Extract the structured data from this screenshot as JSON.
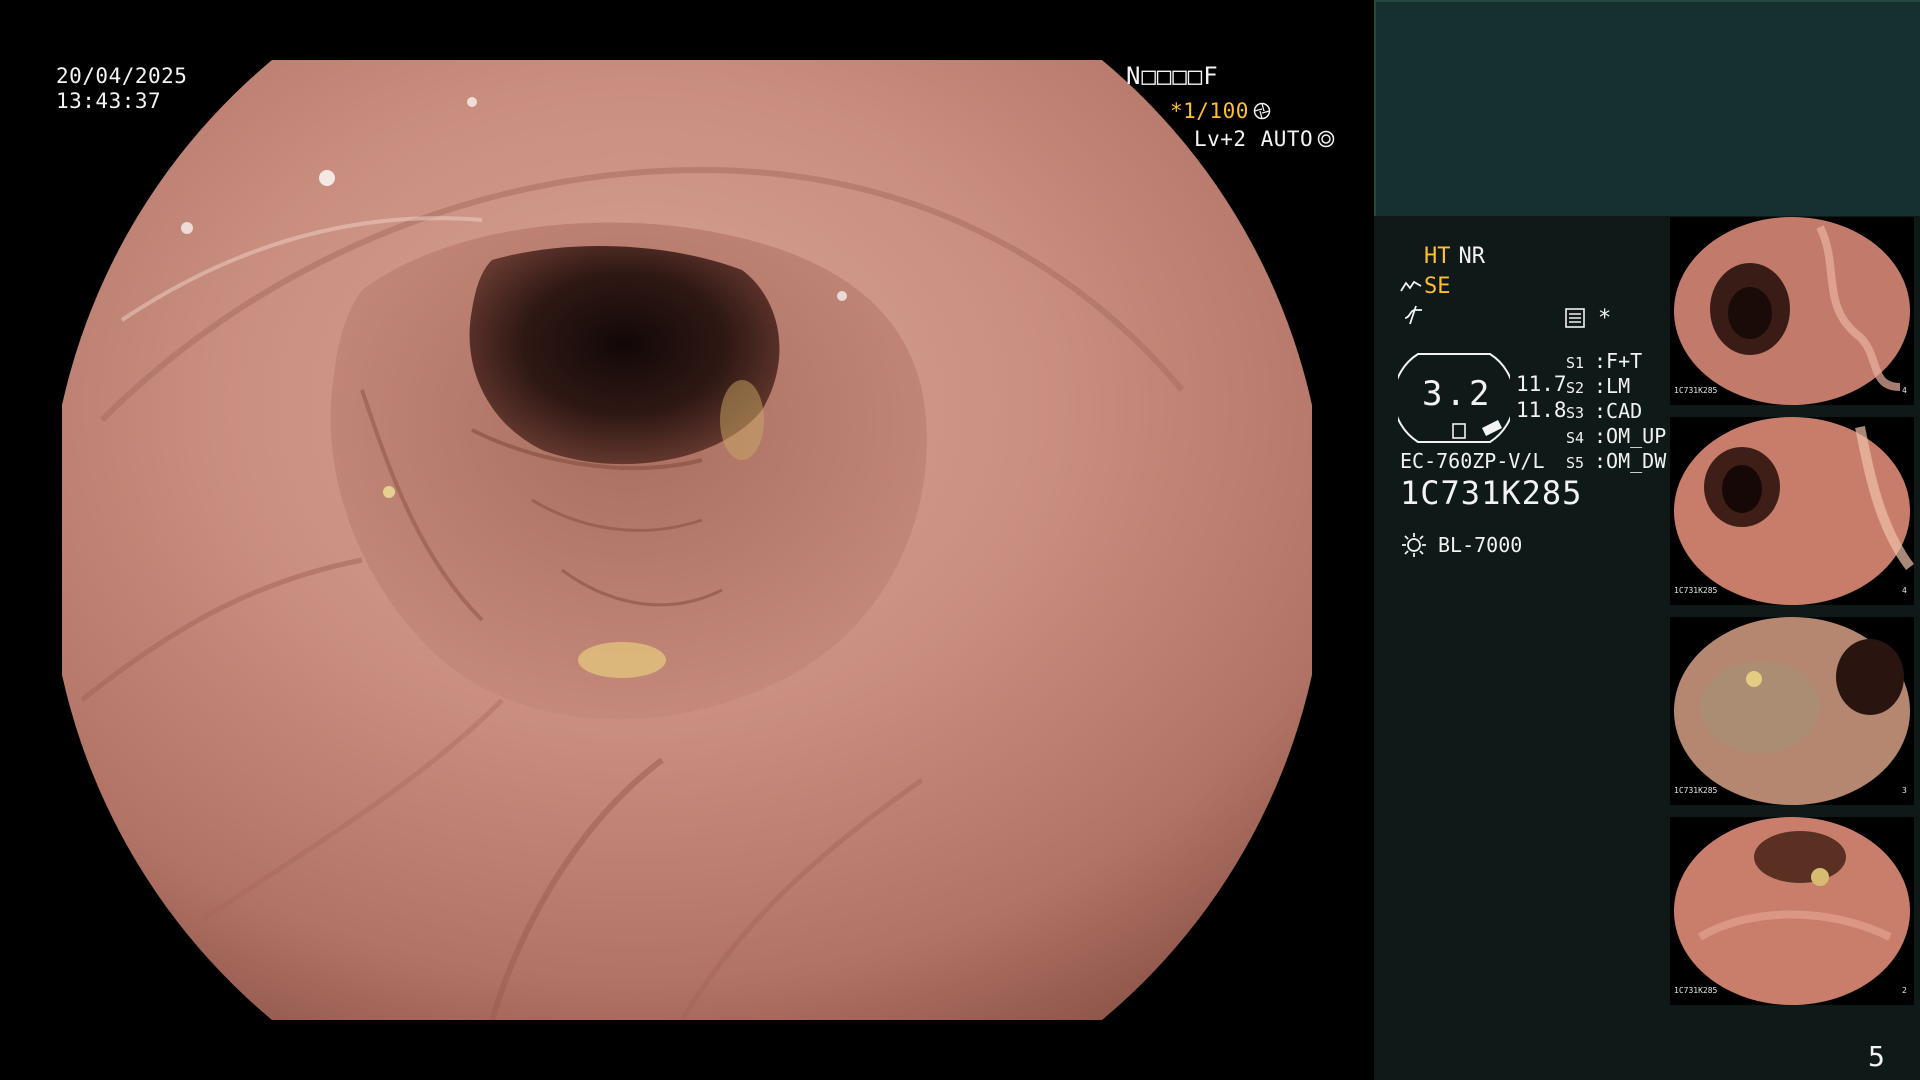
{
  "overlay": {
    "date": "20/04/2025",
    "time": "13:43:37",
    "patient_id": "N□□□□F",
    "shutter": "*1/100",
    "level": "Lv+2",
    "auto": "AUTO"
  },
  "panel": {
    "ht_label": "HT",
    "nr_label": "NR",
    "se_label": "SE",
    "asterisk": "*",
    "gauge_value": "3.2",
    "side_value_1": "11.7",
    "side_value_2": "11.8",
    "scope_model": "EC-760ZP-V/L",
    "scope_serial": "1C731K285",
    "light_source": "BL-7000",
    "presets": [
      {
        "key": "S1",
        "value": "F+T"
      },
      {
        "key": "S2",
        "value": "LM"
      },
      {
        "key": "S3",
        "value": "CAD"
      },
      {
        "key": "S4",
        "value": "OM_UP"
      },
      {
        "key": "S5",
        "value": "OM_DW"
      }
    ],
    "thumbnails": [
      {
        "caption_serial": "1C731K285",
        "index": "4"
      },
      {
        "caption_serial": "1C731K285",
        "index": "4"
      },
      {
        "caption_serial": "1C731K285",
        "index": "3"
      },
      {
        "caption_serial": "1C731K285",
        "index": "2"
      }
    ],
    "page_number": "5"
  },
  "colors": {
    "accent_amber": "#ffbf2e",
    "panel_bg": "#0f1a18",
    "panel_header_bg": "#15312f",
    "mucosa": "#c48a7c"
  },
  "icons": [
    "shutter-icon",
    "auto-iris-icon",
    "structure-enhance-icon",
    "filter-icon",
    "memo-icon",
    "light-source-icon"
  ]
}
